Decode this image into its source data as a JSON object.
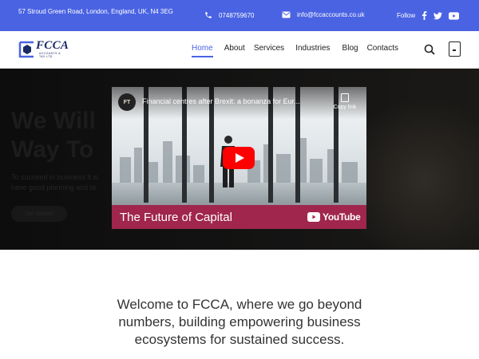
{
  "topbar": {
    "address": "57 Stroud Green Road, London, England, UK, N4 3EG",
    "phone": "0748759670",
    "email": "info@fccaccounts.co.uk",
    "follow_label": "Follow",
    "social_icons": [
      "facebook-icon",
      "twitter-icon",
      "youtube-icon"
    ],
    "color": "#4a63e3"
  },
  "header": {
    "logo_text": "FCCA",
    "logo_sub": "ACCOUNTS & TAX LTD",
    "nav": [
      "Home",
      "About",
      "Services",
      "Industries",
      "Blog",
      "Contacts"
    ],
    "active": "Home",
    "icons": [
      "search-icon",
      "cart-icon"
    ]
  },
  "hero": {
    "headline_line1": "We Will",
    "headline_line2": "Way To",
    "desc_line1": "To succeed in business it is",
    "desc_line2": "have good planning and ta",
    "cta": "Get Started"
  },
  "video": {
    "channel": "FT",
    "title": "Financial centres after Brexit: a bonanza for Eur...",
    "copy_link": "Copy link",
    "banner_text": "The Future of Capital",
    "youtube_label": "YouTube"
  },
  "welcome": {
    "line1": "Welcome to FCCA, where we go beyond",
    "line2": "numbers, building empowering business",
    "line3": "ecosystems for sustained success."
  }
}
